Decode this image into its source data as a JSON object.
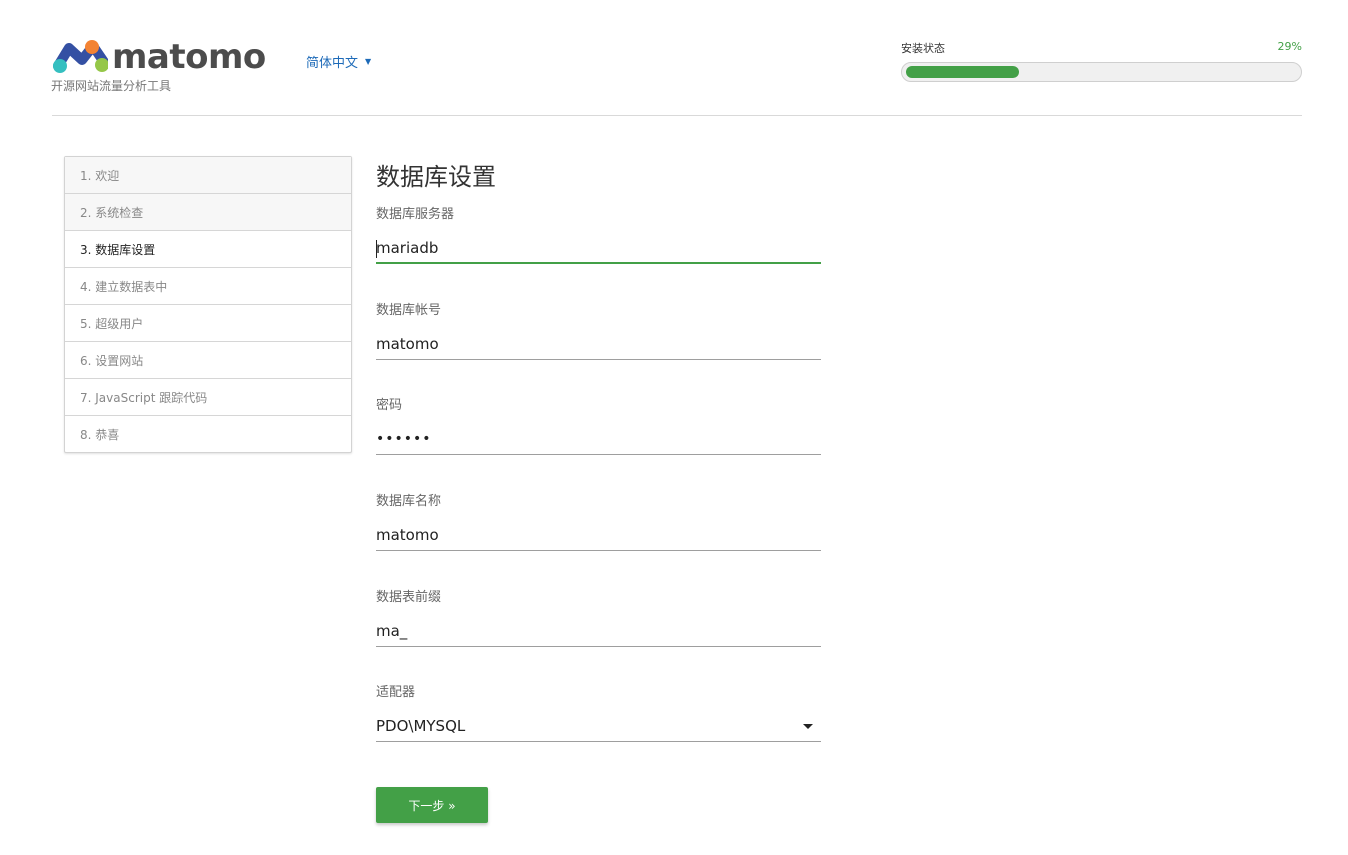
{
  "header": {
    "logo_text": "matomo",
    "tagline": "开源网站流量分析工具",
    "language": "简体中文",
    "progress_label": "安装状态",
    "progress_pct_label": "29%",
    "progress_fraction": 0.29
  },
  "steps": [
    {
      "label": "1. 欢迎",
      "state": "done"
    },
    {
      "label": "2. 系统检查",
      "state": "done"
    },
    {
      "label": "3. 数据库设置",
      "state": "current"
    },
    {
      "label": "4. 建立数据表中",
      "state": "todo"
    },
    {
      "label": "5. 超级用户",
      "state": "todo"
    },
    {
      "label": "6. 设置网站",
      "state": "todo"
    },
    {
      "label": "7. JavaScript 跟踪代码",
      "state": "todo"
    },
    {
      "label": "8. 恭喜",
      "state": "todo"
    }
  ],
  "form": {
    "title": "数据库设置",
    "fields": {
      "host": {
        "label": "数据库服务器",
        "value": "mariadb"
      },
      "username": {
        "label": "数据库帐号",
        "value": "matomo"
      },
      "password": {
        "label": "密码",
        "value": "••••••"
      },
      "dbname": {
        "label": "数据库名称",
        "value": "matomo"
      },
      "prefix": {
        "label": "数据表前缀",
        "value": "ma_"
      },
      "adapter": {
        "label": "适配器",
        "value": "PDO\\MYSQL"
      }
    },
    "next_label": "下一步 »"
  },
  "colors": {
    "accent": "#43a047",
    "link": "#1d6ab8",
    "logo_blue": "#3450a3",
    "logo_teal": "#35bfc0",
    "logo_orange": "#f38334",
    "logo_green": "#95c748"
  }
}
